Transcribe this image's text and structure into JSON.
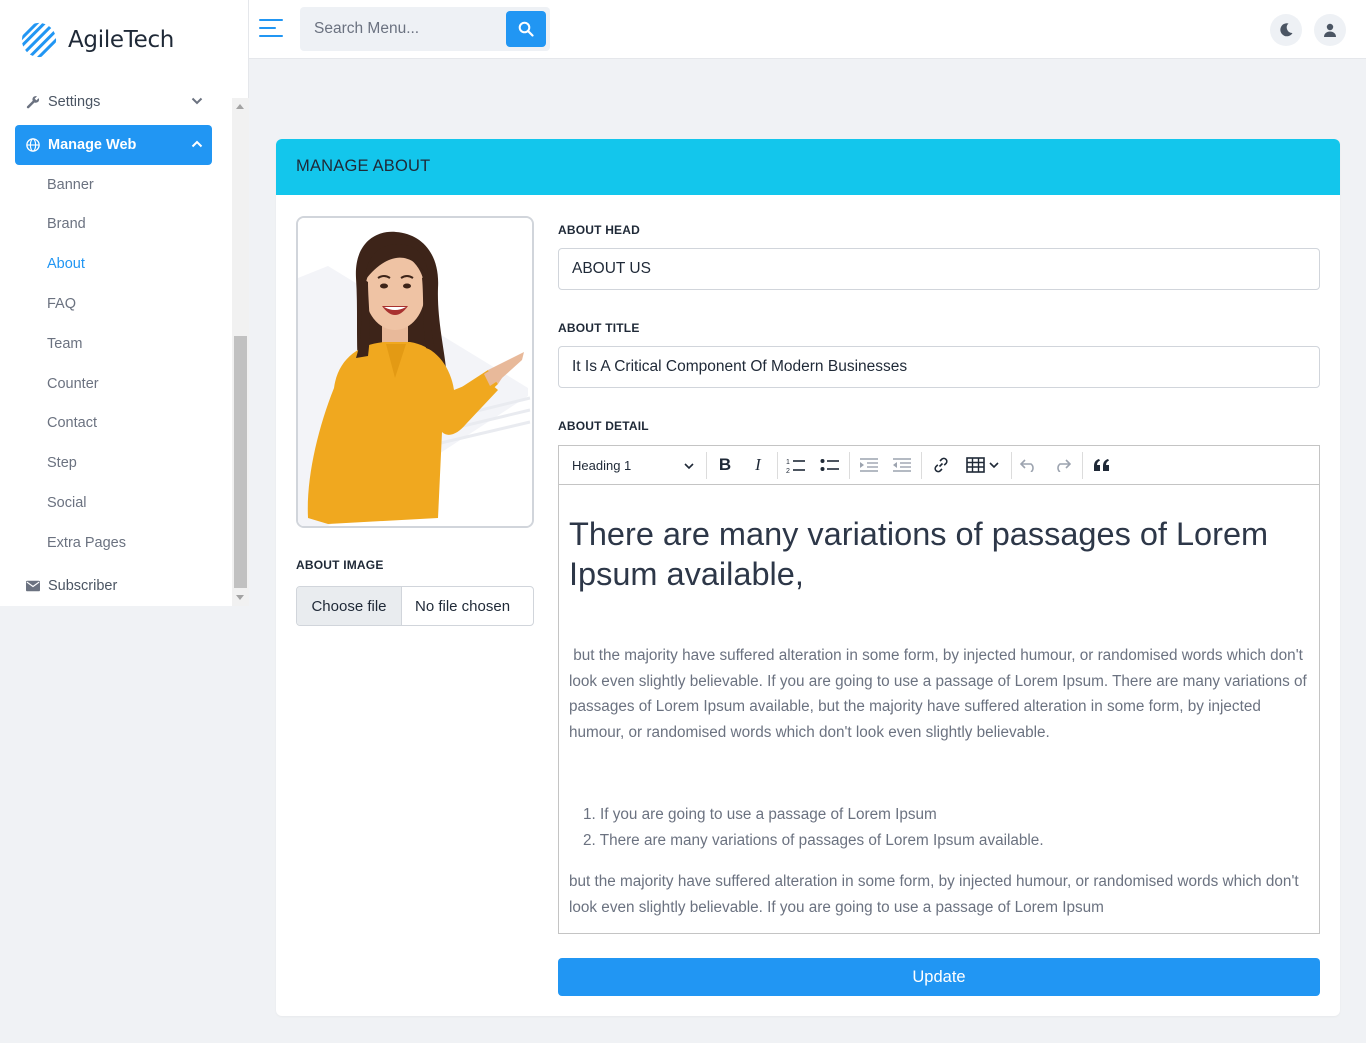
{
  "brand": {
    "name": "AgileTech",
    "accent": "#2196f3",
    "header_color": "#13c6ec"
  },
  "search": {
    "placeholder": "Search Menu..."
  },
  "sidebar": {
    "settings": "Settings",
    "manage_web": "Manage Web",
    "sub_items": [
      "Banner",
      "Brand",
      "About",
      "FAQ",
      "Team",
      "Counter",
      "Contact",
      "Step",
      "Social",
      "Extra Pages"
    ],
    "current_sub": "About",
    "subscriber": "Subscriber"
  },
  "page": {
    "title": "MANAGE ABOUT",
    "about_head": {
      "label": "ABOUT HEAD",
      "value": "ABOUT US"
    },
    "about_title": {
      "label": "ABOUT TITLE",
      "value": "It Is A Critical Component Of Modern Businesses"
    },
    "about_detail": {
      "label": "ABOUT DETAIL",
      "heading_select": "Heading 1",
      "heading": "There are many variations of passages of Lorem Ipsum available,",
      "paragraph1": " but the majority have suffered alteration in some form, by injected humour, or randomised words which don't look even slightly believable. If you are going to use a passage of Lorem Ipsum. There are many variations of passages of Lorem Ipsum available, but the majority have suffered alteration in some form, by injected humour, or randomised words which don't look even slightly believable.",
      "list": [
        "1. If you are going to use a passage of Lorem Ipsum",
        "2. There are many variations of passages of Lorem Ipsum available."
      ],
      "paragraph2": "but the majority have suffered alteration in some form, by injected humour, or randomised words which don't look even slightly believable. If you are going to use a passage of Lorem Ipsum"
    },
    "about_image": {
      "label": "ABOUT IMAGE",
      "choose_button": "Choose file",
      "file_status": "No file chosen"
    },
    "update_button": "Update"
  },
  "icons": [
    "hamburger-icon",
    "search-icon",
    "moon-icon",
    "user-icon",
    "wrench-icon",
    "globe-icon",
    "envelope-icon",
    "chevron-down-icon",
    "chevron-up-icon"
  ]
}
